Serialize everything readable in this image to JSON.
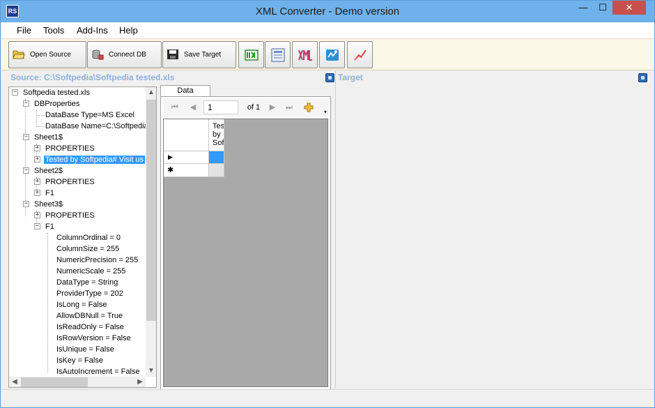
{
  "window": {
    "title": "XML Converter - Demo version",
    "icon_text": "RS",
    "minimize_glyph": "—",
    "maximize_glyph": "☐",
    "close_glyph": "✕"
  },
  "menu": [
    "File",
    "Tools",
    "Add-Ins",
    "Help"
  ],
  "toolbar": {
    "open_source": "Open Source",
    "connect_db": "Connect DB",
    "save_target": "Save Target",
    "icon_buttons": [
      "convert-icon",
      "form-icon",
      "xml-icon",
      "map-icon",
      "chart-icon"
    ]
  },
  "source_pane": {
    "title": "Source: C:\\Softpedia\\Softpedia tested.xls"
  },
  "target_pane": {
    "title": "Target"
  },
  "tree": {
    "root": "Softpedia tested.xls",
    "dbproperties": "DBProperties",
    "db_type": "DataBase Type=MS Excel",
    "db_name": "DataBase Name=C:\\Softpedia",
    "sheet1": "Sheet1$",
    "sheet1_properties": "PROPERTIES",
    "sheet1_tested": "Tested by Softpedia# Visit us",
    "sheet2": "Sheet2$",
    "sheet2_properties": "PROPERTIES",
    "sheet2_f1": "F1",
    "sheet3": "Sheet3$",
    "sheet3_properties": "PROPERTIES",
    "sheet3_f1": "F1",
    "f1_props": [
      "ColumnOrdinal = 0",
      "ColumnSize = 255",
      "NumericPrecision = 255",
      "NumericScale = 255",
      "DataType = String",
      "ProviderType = 202",
      "IsLong = False",
      "AllowDBNull = True",
      "IsReadOnly = False",
      "IsRowVersion = False",
      "IsUnique = False",
      "IsKey = False",
      "IsAutoIncrement = False"
    ]
  },
  "data_tab": {
    "tab_label": "Data",
    "position": "1",
    "of_label": "of 1",
    "column_header": "Tested by Softpedia",
    "row_indicator": "▶",
    "new_row_indicator": "✱"
  }
}
